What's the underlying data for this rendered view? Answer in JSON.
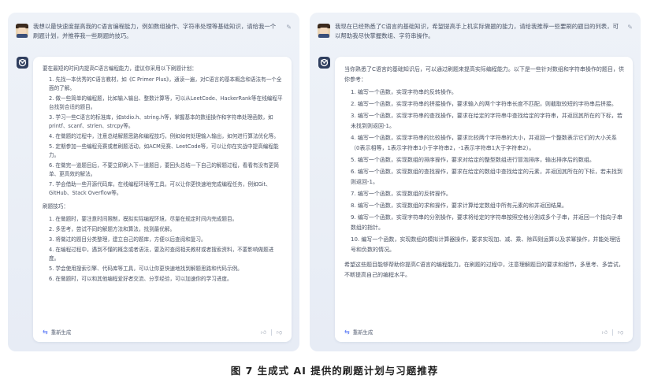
{
  "left": {
    "user_message": "我想以最快速度提高我的C语言编程能力，例如数组操作、字符串处理等基础知识，请给我一个刷题计划，并推荐我一些刷题的技巧。",
    "intro": "要在最短的时间内提高C语言编程能力，建议你采用以下刷题计划：",
    "plan": [
      "1. 先找一本优秀的C语言教材，如《C Primer Plus》，通读一遍，对C语言的基本概念和语法有一个全面的了解。",
      "2. 做一些简单的编程题，比如输入输出、整数计算等，可以从LeetCode、HackerRank等在线编程平台找到合适的题目。",
      "3. 学习一些C语言的标准库，如stdio.h、string.h等，掌握基本的数组操作和字符串处理函数，如printf、scanf、strlen、strcpy等。",
      "4. 在做题的过程中，注意总结解题思路和编程技巧，例如如何处理输入输出，如何进行算法优化等。",
      "5. 定期参加一些编程竞赛或者刷题活动，如ACM竞赛、LeetCode等，可以让你在实战中提高编程能力。",
      "6. 在做完一道题目后，不要立即刷入下一道题目，要回头总结一下自己的解题过程，看看有没有更简单、更高效的解法。",
      "7. 学会借助一些开源代码库，在线编程环境等工具，可以让你更快速地完成编程任务，例如Git、GitHub、Stack Overflow等。"
    ],
    "tips_heading": "刷题技巧：",
    "tips": [
      "1. 在做题时，要注意时间限制，模拟实际编程环境，尽量在规定时间内完成题目。",
      "2. 多思考，尝试不同的解题方法和算法，找到最优解。",
      "3. 将做过的题目分类整理，建立自己的题库，方便以后查阅和复习。",
      "4. 在编程过程中，遇到不懂的概念或者语法，要及时查阅相关教材或者搜索资料，不要影响做题进度。",
      "5. 学会使用搜索引擎、代码库等工具，可以让你更快速地找到解题思路和代码示例。",
      "6. 在做题时，可以和其他编程爱好者交流、分享经验，可以加速你的学习进度。"
    ],
    "regen_label": "重新生成"
  },
  "right": {
    "user_message": "我现在已经熟悉了C语言的基础知识，希望提高手上机实际做题的能力，请给我推荐一些要刷的题目的列表，可以帮助我尽快掌握数组、字符串操作。",
    "intro": "当你熟悉了C语言的基础知识后，可以通过刷题来提高实际编程能力。以下是一些针对数组和字符串操作的题目，供你参考：",
    "problems": [
      "1. 编写一个函数，实现字符串的反转操作。",
      "2. 编写一个函数，实现字符串的拼接操作，要求输入的两个字符串长度不匹配，则截取较短的字符串后拼接。",
      "3. 编写一个函数，实现字符串的查找操作，要求在给定的字符串中查找给定的字符串，并返回其所在的下标，若未找到则返回-1。",
      "4. 编写一个函数，实现字符串的比较操作，要求比较两个字符串的大小，并返回一个整数表示它们的大小关系（0表示相等，1表示字符串1小于字符串2，-1表示字符串1大于字符串2）。",
      "5. 编写一个函数，实现数组的排序操作，要求对给定的整型数组进行冒泡排序，输出排序后的数组。",
      "6. 编写一个函数，实现数组的查找操作，要求在给定的数组中查找给定的元素，并返回其所在的下标，若未找到则返回-1。",
      "7. 编写一个函数，实现数组的反转操作。",
      "8. 编写一个函数，实现数组的求和操作，要求计算给定数组中所有元素的和并返回结果。",
      "9. 编写一个函数，实现字符串的分割操作，要求将给定的字符串按照空格分割成多个子串，并返回一个指向子串数组的指针。",
      "10. 编写一个函数，实现数组的模拟计算器操作，要求实现加、减、乘、除四则运算以及求幂操作，并能处理括号和负数的情况。"
    ],
    "outro": "希望这些题目能够帮助你提高C语言的编程能力。在刷题的过程中，注意理解题目的要求和细节，多思考、多尝试，不断提高自己的编程水平。",
    "regen_label": "重新生成"
  },
  "caption": "图 7   生成式 AI 提供的刷题计划与习题推荐",
  "icons": {
    "edit": "pencil-icon",
    "regen": "refresh-icon",
    "like": "thumbs-up-icon",
    "dislike": "thumbs-down-icon",
    "bot": "bot-logo-icon",
    "user": "user-avatar-icon"
  },
  "colors": {
    "panel_bg": "#e9eef6",
    "card_bg": "#ffffff",
    "accent": "#4c6ef5",
    "caption": "#1f1f1f"
  }
}
